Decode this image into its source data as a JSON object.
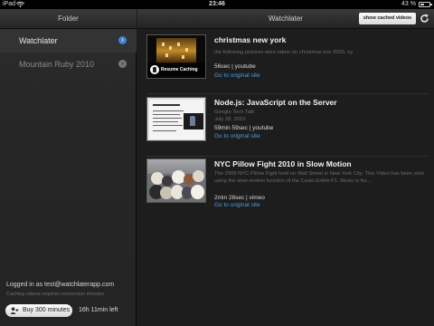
{
  "status_bar": {
    "carrier": "iPad",
    "time": "23:46",
    "battery": "43 %",
    "battery_fraction": 0.43
  },
  "sidebar": {
    "title": "Folder",
    "items": [
      {
        "label": "Watchlater",
        "selected": true
      },
      {
        "label": "Mountain Ruby 2010",
        "selected": false
      }
    ],
    "login_text": "Logged in as test@watchlaterapp.com",
    "note": "Caching videos requires conversion minutes",
    "buy_button": "Buy 300 minutes",
    "time_left": "16h 11min left"
  },
  "main": {
    "title": "Watchlater",
    "cached_button": "show cached videos",
    "videos": [
      {
        "title": "christmas new york",
        "subtitle": "",
        "description": "the following pictures were taken on christmas eve 2003. ny",
        "meta": "56sec | youtube",
        "link": "Go to original site",
        "thumb_overlay": "Resume  Caching"
      },
      {
        "title": "Node.js: JavaScript on the Server",
        "subtitle": "Google Tech Talk",
        "date": "July 28, 2010",
        "meta": "59min 59sec | youtube",
        "link": "Go to original site"
      },
      {
        "title": "NYC Pillow Fight 2010 in Slow Motion",
        "description": "The 2009 NYC Pillow Fight held on Wall Street in New York City. This Video has been shot using the slow-motion function of the Casio Exilim F1. Music is fro...",
        "meta": "2min 28sec | vimeo",
        "link": "Go to original site"
      }
    ]
  },
  "colors": {
    "accent": "#3f86d1",
    "link": "#4f9be0"
  }
}
